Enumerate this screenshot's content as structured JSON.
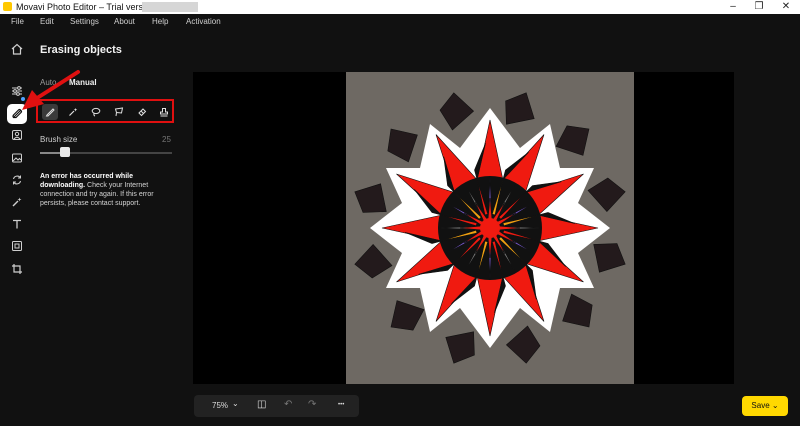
{
  "titlebar": {
    "title": "Movavi Photo Editor – Trial version –",
    "minimize": "–",
    "maximize": "❐",
    "close": "✕"
  },
  "menu": [
    "File",
    "Edit",
    "Settings",
    "About",
    "Help",
    "Activation"
  ],
  "sidebar": {
    "items": [
      "home-icon",
      "sliders-icon",
      "eraser-icon",
      "portrait-icon",
      "image-icon",
      "rotate-icon",
      "magic-wand-icon",
      "text-icon",
      "frame-icon",
      "crop-icon"
    ],
    "active": "eraser-icon",
    "accent": "#4ea3ff"
  },
  "panel": {
    "title": "Erasing objects",
    "mode_auto": "Auto",
    "mode_manual": "Manual",
    "tools": [
      "brush-icon",
      "magic-brush-icon",
      "lasso-icon",
      "polygon-lasso-icon",
      "eraser-icon",
      "stamp-icon"
    ],
    "brush_label": "Brush size",
    "brush_value": "25",
    "brush_fraction": 0.19,
    "error_bold": "An error has occurred while downloading.",
    "error_text": " Check your Internet connection and try again. If this error persists, please contact support."
  },
  "bottom": {
    "zoom": "75%",
    "zoom_caret": "⌄",
    "compare": "◫",
    "undo": "↶",
    "redo": "↷",
    "more": "•••"
  },
  "save": {
    "label": "Save",
    "caret": "⌄",
    "color": "#ffd800"
  },
  "annotation": {
    "arrow_color": "#e01010",
    "box_color": "#e01010"
  }
}
